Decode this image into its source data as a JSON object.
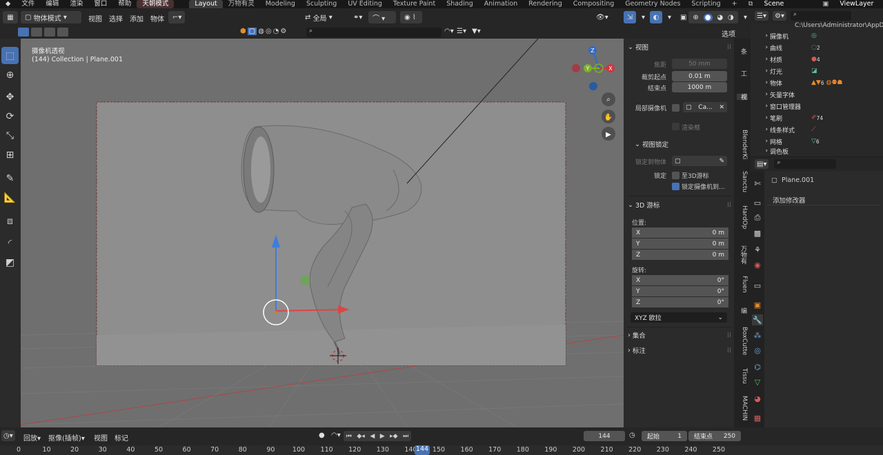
{
  "menu": {
    "items": [
      "文件",
      "编辑",
      "渲染",
      "窗口",
      "帮助"
    ],
    "mode_label": "天朝模式",
    "workspaces": [
      "Layout",
      "万物有灵",
      "Modeling",
      "Sculpting",
      "UV Editing",
      "Texture Paint",
      "Shading",
      "Animation",
      "Rendering",
      "Compositing",
      "Geometry Nodes",
      "Scripting"
    ],
    "active_workspace": "Layout",
    "scene": "Scene",
    "view_layer": "ViewLayer"
  },
  "header": {
    "object_mode": "物体模式",
    "menus": [
      "视图",
      "选择",
      "添加",
      "物体"
    ],
    "orientation": "全局",
    "options": "选项"
  },
  "viewport": {
    "title": "摄像机透视",
    "subtitle": "(144) Collection | Plane.001",
    "gizmo": {
      "x": "X",
      "y": "Y",
      "z": "Z"
    },
    "colors": {
      "x": "#d0343f",
      "y": "#7db028",
      "z": "#2e6bc9",
      "bg": "#6f6f6f",
      "frame": "#8e8e8e"
    }
  },
  "side_tabs": [
    "条",
    "工",
    "视",
    "BlenderKi",
    "Sanctu",
    "HardOp",
    "万物有",
    "Fluen",
    "编",
    "BoxCutte",
    "Tissu",
    "MACHIN"
  ],
  "npanel": {
    "view_header": "视图",
    "focal_label": "焦距",
    "focal_value": "50 mm",
    "clip_start_label": "裁剪起点",
    "clip_start_value": "0.01 m",
    "clip_end_label": "结束点",
    "clip_end_value": "1000 m",
    "local_cam_label": "局部摄像机",
    "local_cam_value": "Ca...",
    "render_border": "渲染框",
    "view_lock_header": "视图锁定",
    "lock_to_object": "锁定到物体",
    "lock_label": "锁定",
    "lock_to_cursor": "至3D游标",
    "lock_camera": "锁定摄像机到...",
    "cursor_header": "3D 游标",
    "location_label": "位置:",
    "location": [
      {
        "axis": "X",
        "value": "0 m"
      },
      {
        "axis": "Y",
        "value": "0 m"
      },
      {
        "axis": "Z",
        "value": "0 m"
      }
    ],
    "rotation_label": "旋转:",
    "rotation": [
      {
        "axis": "X",
        "value": "0°"
      },
      {
        "axis": "Y",
        "value": "0°"
      },
      {
        "axis": "Z",
        "value": "0°"
      }
    ],
    "rotation_mode": "XYZ 欧拉",
    "collection_header": "集合",
    "annotation_header": "标注"
  },
  "outliner": {
    "path": "C:\\Users\\Administrator\\AppDa",
    "rows": [
      {
        "label": "摄像机",
        "badge": ""
      },
      {
        "label": "曲线",
        "badge": "2"
      },
      {
        "label": "材质",
        "badge": "4"
      },
      {
        "label": "灯光",
        "badge": ""
      },
      {
        "label": "物体",
        "badge": "6"
      },
      {
        "label": "矢量字体",
        "badge": ""
      },
      {
        "label": "窗口管理器",
        "badge": ""
      },
      {
        "label": "笔刷",
        "badge": "74"
      },
      {
        "label": "线条样式",
        "badge": ""
      },
      {
        "label": "网格",
        "badge": "6"
      },
      {
        "label": "调色板",
        "badge": ""
      }
    ]
  },
  "properties": {
    "object_name": "Plane.001",
    "add_modifier": "添加修改器"
  },
  "timeline": {
    "playback": "回放",
    "keying": "抠像(插帧)",
    "view": "视图",
    "marker": "标记",
    "current_frame": "144",
    "start_label": "起始",
    "start_value": "1",
    "end_label": "结束点",
    "end_value": "250",
    "ticks": [
      "0",
      "10",
      "20",
      "30",
      "40",
      "50",
      "60",
      "70",
      "80",
      "90",
      "100",
      "110",
      "120",
      "130",
      "140",
      "150",
      "160",
      "170",
      "180",
      "190",
      "200",
      "210",
      "220",
      "230",
      "240",
      "250"
    ]
  }
}
